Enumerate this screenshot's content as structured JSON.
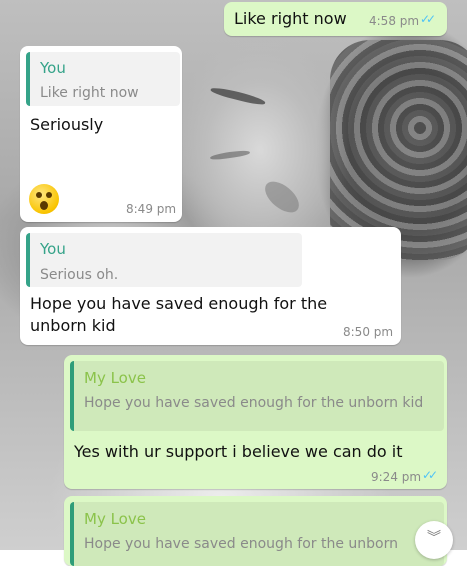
{
  "colors": {
    "outgoing_bubble": "#dcf8c6",
    "incoming_bubble": "#ffffff",
    "read_ticks": "#4fc3f7",
    "quote_author_you": "#35a389",
    "quote_author_mylove": "#8bc34a"
  },
  "icons": {
    "read_receipt": "double-check-icon",
    "emoji": "astonished-face-emoji",
    "scroll_down": "chevron-double-down-icon"
  },
  "messages": [
    {
      "text": "Like right now",
      "time": "4:58 pm"
    },
    {
      "quote_author": "You",
      "quote_text": "Like right now",
      "text": "Seriously",
      "emoji": "😲",
      "time": "8:49 pm"
    },
    {
      "quote_author": "You",
      "quote_text": "Serious oh.",
      "text": "Hope you have saved enough for the unborn kid",
      "time": "8:50 pm"
    },
    {
      "quote_author": "My Love",
      "quote_text": "Hope you have saved enough for the unborn kid",
      "text": "Yes with ur support i believe we can do it",
      "time": "9:24 pm"
    },
    {
      "quote_author": "My Love",
      "quote_text": "Hope you have saved enough for the unborn"
    }
  ]
}
